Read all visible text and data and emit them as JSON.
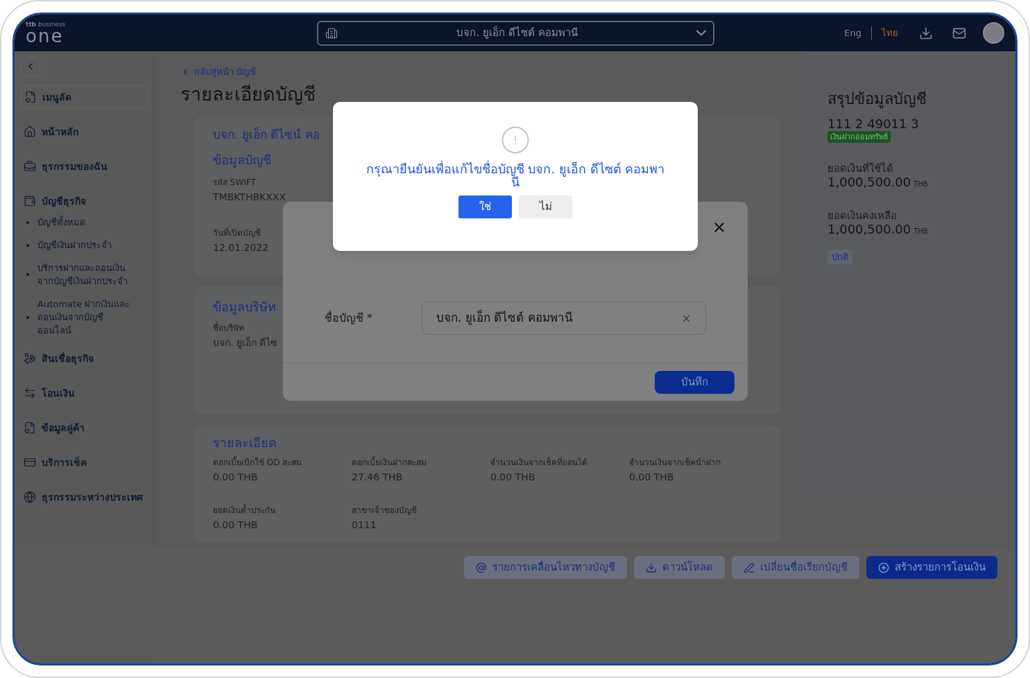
{
  "header": {
    "logo": {
      "brand": "ttb",
      "tagline": "business",
      "name": "one"
    },
    "company_selector": "บจก. ยูเอ็ก ดีไซต์ คอมพานี",
    "languages": [
      {
        "label": "Eng",
        "selected": false
      },
      {
        "label": "ไทย",
        "selected": true
      }
    ]
  },
  "sidebar": {
    "items": [
      {
        "kind": "shortcut",
        "label": "เมนูลัด"
      },
      {
        "kind": "item",
        "label": "หน้าหลัก"
      },
      {
        "kind": "item",
        "label": "ธุรกรรมของฉัน"
      },
      {
        "kind": "item",
        "label": "บัญชีธุรกิจ",
        "children": [
          {
            "label": "บัญชีทั้งหมด"
          },
          {
            "label": "บัญชีเงินฝากประจำ"
          },
          {
            "label": "บริการฝากและถอนเงินจากบัญชีเงินฝากประจำ"
          },
          {
            "label": "Automate ฝากเงินและถอนเงินจากบัญชีออนไลน์"
          }
        ]
      },
      {
        "kind": "item",
        "label": "สินเชื่อธุรกิจ"
      },
      {
        "kind": "item",
        "label": "โอนเงิน"
      },
      {
        "kind": "item",
        "label": "ข้อมูลคู่ค้า"
      },
      {
        "kind": "item",
        "label": "บริการเช็ค"
      },
      {
        "kind": "item",
        "label": "ธุรกรรมระหว่างประเทศ"
      }
    ]
  },
  "main": {
    "back_link": "กลับสู่หน้า บัญชี",
    "title": "รายละเอียดบัญชี",
    "account_card": {
      "title": "บจก. ยูเอ็ก ดีไซน์ คอ",
      "section": "ข้อมูลบัญชี",
      "fields": [
        {
          "label": "รหัส SWIFT",
          "value": "TMBKTHBKXXX"
        },
        {
          "label": "วันที่เปิดบัญชี",
          "value": "12.01.2022"
        }
      ]
    },
    "company_card": {
      "section": "ข้อมูลบริษัท",
      "fields": [
        {
          "label": "ชื่อบริษัท",
          "value": "บจก. ยูเอ็ก ดีไซ"
        }
      ]
    },
    "detail_card": {
      "section": "รายละเอียด",
      "fields": [
        {
          "label": "ดอกเบี้ยเบิกใช้ OD สะสม",
          "value": "0.00 THB"
        },
        {
          "label": "ดอกเบี้ยเงินฝากสะสม",
          "value": "27.46 THB"
        },
        {
          "label": "จำนวนเงินจากเช็คที่ถอนได้",
          "value": "0.00 THB"
        },
        {
          "label": "จำนวนเงินจากเช็คนำฝาก",
          "value": "0.00 THB"
        },
        {
          "label": "ยอดเงินค้ำประกัน",
          "value": "0.00 THB"
        },
        {
          "label": "สาขาเจ้าของบัญชี",
          "value": "0111"
        }
      ]
    }
  },
  "summary": {
    "title": "สรุปข้อมูลบัญชี",
    "account_number": "111 2 49011 3",
    "account_type": "เงินฝากออมทรัพย์",
    "balances": [
      {
        "label": "ยอดเงินที่ใช้ได้",
        "amount": "1,000,500.00",
        "currency": "THB"
      },
      {
        "label": "ยอดเงินคงเหลือ",
        "amount": "1,000,500.00",
        "currency": "THB"
      }
    ],
    "status": "ปกติ"
  },
  "actions": [
    {
      "kind": "secondary",
      "label": "รายการเคลื่อนไหวทางบัญชี"
    },
    {
      "kind": "secondary",
      "label": "ดาวน์โหลด"
    },
    {
      "kind": "secondary",
      "label": "เปลี่ยนชื่อเรียกบัญชี"
    },
    {
      "kind": "primary",
      "label": "สร้างรายการโอนเงิน"
    }
  ],
  "edit_dialog": {
    "field_label": "ชื่อบัญชี *",
    "value": "บจก. ยูเอ็ก ดีไซต์ คอมพานี",
    "save": "บันทึก"
  },
  "confirm_dialog": {
    "message": "กรุณายืนยันเพื่อแก้ไขชื่อบัญชี บจก. ยูเอ็ก ดีไซต์ คอมพานี",
    "buttons": [
      {
        "kind": "primary",
        "label": "ใช่"
      },
      {
        "kind": "secondary",
        "label": "ไม่"
      }
    ]
  }
}
